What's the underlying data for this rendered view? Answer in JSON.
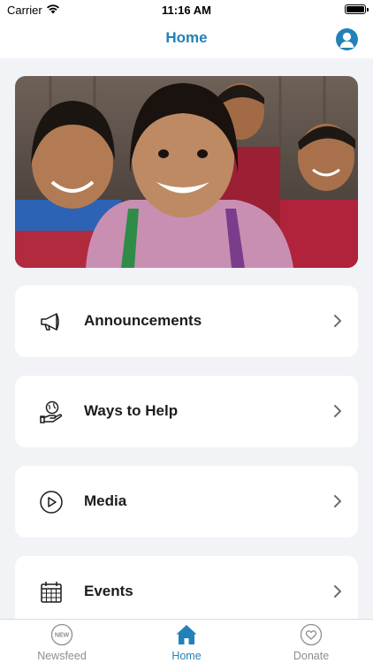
{
  "status_bar": {
    "carrier": "Carrier",
    "time": "11:16 AM"
  },
  "nav": {
    "title": "Home"
  },
  "hero": {
    "image": "children-smiling-photo"
  },
  "menu": [
    {
      "label": "Announcements",
      "icon": "megaphone-icon"
    },
    {
      "label": "Ways to Help",
      "icon": "hand-globe-icon"
    },
    {
      "label": "Media",
      "icon": "play-circle-icon"
    },
    {
      "label": "Events",
      "icon": "calendar-icon"
    }
  ],
  "tab_bar": {
    "tabs": [
      {
        "label": "Newsfeed",
        "icon": "new-badge-icon",
        "badge": "NEW",
        "active": false
      },
      {
        "label": "Home",
        "icon": "home-icon",
        "active": true
      },
      {
        "label": "Donate",
        "icon": "heart-icon",
        "active": false
      }
    ]
  },
  "colors": {
    "accent": "#2281b8",
    "background": "#f2f3f7",
    "inactive": "#8e8e93"
  }
}
